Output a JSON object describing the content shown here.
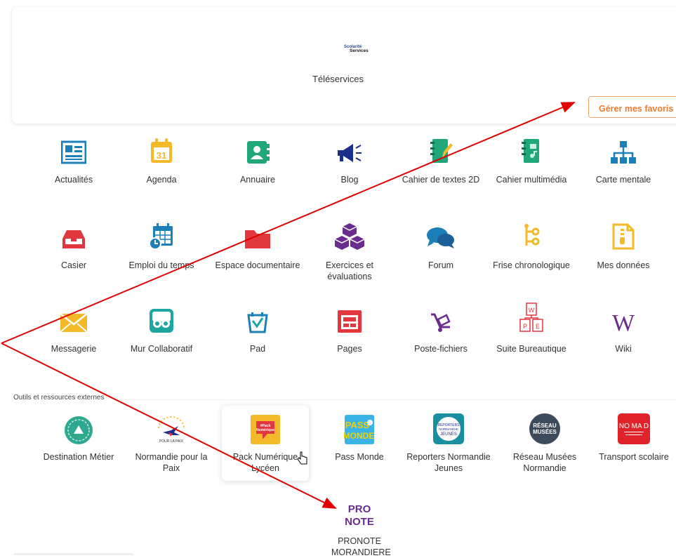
{
  "header": {
    "logo_line1": "Scolarité",
    "logo_line2": "Services",
    "title": "Téléservices",
    "favorites_button": "Gérer mes favoris"
  },
  "apps": [
    {
      "label": "Actualités",
      "icon": "newspaper-icon"
    },
    {
      "label": "Agenda",
      "icon": "calendar-31-icon"
    },
    {
      "label": "Annuaire",
      "icon": "contact-book-icon"
    },
    {
      "label": "Blog",
      "icon": "megaphone-icon"
    },
    {
      "label": "Cahier de textes 2D",
      "icon": "notebook-pencil-icon"
    },
    {
      "label": "Cahier multimédia",
      "icon": "multimedia-notebook-icon"
    },
    {
      "label": "Carte mentale",
      "icon": "sitemap-icon"
    },
    {
      "label": "Casier",
      "icon": "inbox-tray-icon"
    },
    {
      "label": "Emploi du temps",
      "icon": "calendar-clock-icon"
    },
    {
      "label": "Espace documentaire",
      "icon": "folder-icon"
    },
    {
      "label": "Exercices et évaluations",
      "icon": "cubes-icon"
    },
    {
      "label": "Forum",
      "icon": "chat-bubbles-icon"
    },
    {
      "label": "Frise chronologique",
      "icon": "timeline-icon"
    },
    {
      "label": "Mes données",
      "icon": "zip-file-icon"
    },
    {
      "label": "Messagerie",
      "icon": "envelope-icon"
    },
    {
      "label": "Mur Collaboratif",
      "icon": "collab-wall-icon"
    },
    {
      "label": "Pad",
      "icon": "pad-icon"
    },
    {
      "label": "Pages",
      "icon": "pages-icon"
    },
    {
      "label": "Poste-fichiers",
      "icon": "hand-truck-icon"
    },
    {
      "label": "Suite Bureautique",
      "icon": "office-suite-icon"
    },
    {
      "label": "Wiki",
      "icon": "wiki-icon"
    }
  ],
  "external_section": {
    "title": "Outils et ressources externes",
    "items": [
      {
        "label": "Destination Métier",
        "icon": "destination-metier-logo"
      },
      {
        "label": "Normandie pour la Paix",
        "icon": "normandie-paix-logo",
        "logo_text": "POUR LA PAIX"
      },
      {
        "label": "Pack Numérique Lycéen",
        "icon": "pack-numerique-logo",
        "logo_text": "#Pack Numérique Lycéen"
      },
      {
        "label": "Pass Monde",
        "icon": "pass-monde-logo",
        "logo_text": "PASS MONDE"
      },
      {
        "label": "Reporters Normandie Jeunes",
        "icon": "reporters-logo",
        "logo_text": "REPORTERS NORMANDIE JEUNES"
      },
      {
        "label": "Réseau Musées Normandie",
        "icon": "reseau-musees-logo",
        "logo_text": "RÉSEAU MUSÉES"
      },
      {
        "label": "Transport scolaire",
        "icon": "nomad-logo",
        "logo_text": "NO MA D"
      },
      {
        "label": "PRONOTE MORANDIERE",
        "icon": "pronote-logo",
        "logo_text": "PRO NOTE"
      }
    ]
  },
  "colors": {
    "accent_orange": "#ee7c2e",
    "annotation_arrow": "#e00000"
  }
}
